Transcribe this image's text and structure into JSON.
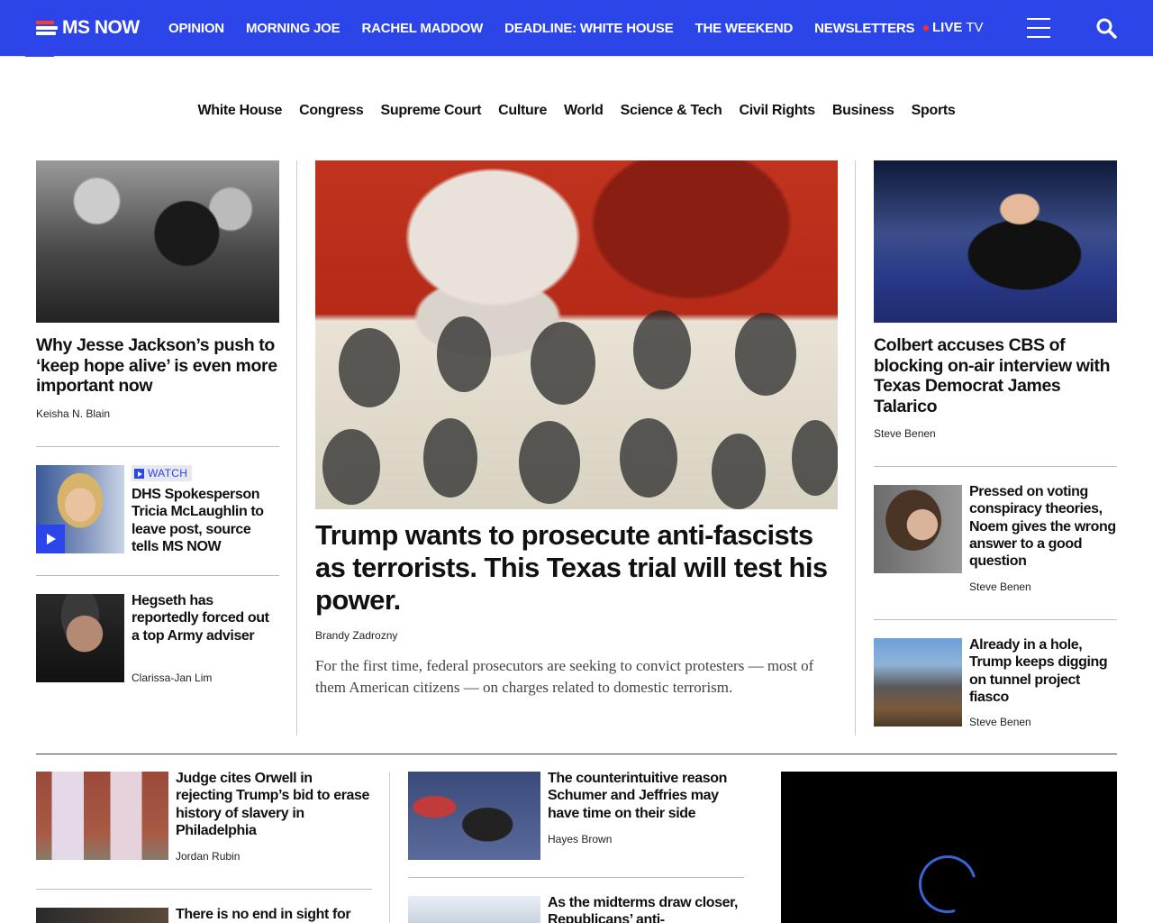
{
  "brand": {
    "logo_text": "MS NOW"
  },
  "topnav": {
    "links": [
      "OPINION",
      "MORNING JOE",
      "RACHEL MADDOW",
      "DEADLINE: WHITE HOUSE",
      "THE WEEKEND",
      "NEWSLETTERS"
    ],
    "live_bold": "LIVE",
    "live_rest": "TV"
  },
  "sections": [
    "White House",
    "Congress",
    "Supreme Court",
    "Culture",
    "World",
    "Science & Tech",
    "Civil Rights",
    "Business",
    "Sports"
  ],
  "left_column": {
    "top_story": {
      "headline": "Why Jesse Jackson’s push to ‘keep hope alive’ is even more important now",
      "byline": "Keisha N. Blain"
    },
    "watch_story": {
      "badge": "WATCH",
      "headline": "DHS Spokesperson Tricia McLaughlin to leave post, source tells MS NOW"
    },
    "story3": {
      "headline": "Hegseth has reportedly forced out a top Army adviser",
      "byline": "Clarissa-Jan Lim"
    }
  },
  "center": {
    "headline": "Trump wants to prosecute anti-fascists as terrorists. This Texas trial will test his power.",
    "byline": "Brandy Zadrozny",
    "lede": "For the first time, federal prosecutors are seeking to convict protesters — most of them American citizens — on charges related to domestic terrorism."
  },
  "right_column": {
    "top_story": {
      "headline": "Colbert accuses CBS of blocking on-air interview with Texas Democrat James Talarico",
      "byline": "Steve Benen"
    },
    "story2": {
      "headline": "Pressed on voting conspiracy theories, Noem gives the wrong answer to a good question",
      "byline": "Steve Benen"
    },
    "story3": {
      "headline": "Already in a hole, Trump keeps digging on tunnel project fiasco",
      "byline": "Steve Benen"
    }
  },
  "bottom": {
    "col1": [
      {
        "headline": "Judge cites Orwell in rejecting Trump’s bid to erase history of slavery in Philadelphia",
        "byline": "Jordan Rubin"
      },
      {
        "headline": "There is no end in sight for"
      }
    ],
    "col2": [
      {
        "headline": "The counterintuitive reason Schumer and Jeffries may have time on their side",
        "byline": "Hayes Brown"
      },
      {
        "headline": "As the midterms draw closer, Republicans’ anti-"
      }
    ]
  },
  "colors": {
    "brand_blue": "#2b45e8",
    "live_red": "#ff2b2b"
  },
  "icons": [
    "hamburger-menu-icon",
    "search-icon",
    "play-icon",
    "loading-spinner-icon"
  ]
}
